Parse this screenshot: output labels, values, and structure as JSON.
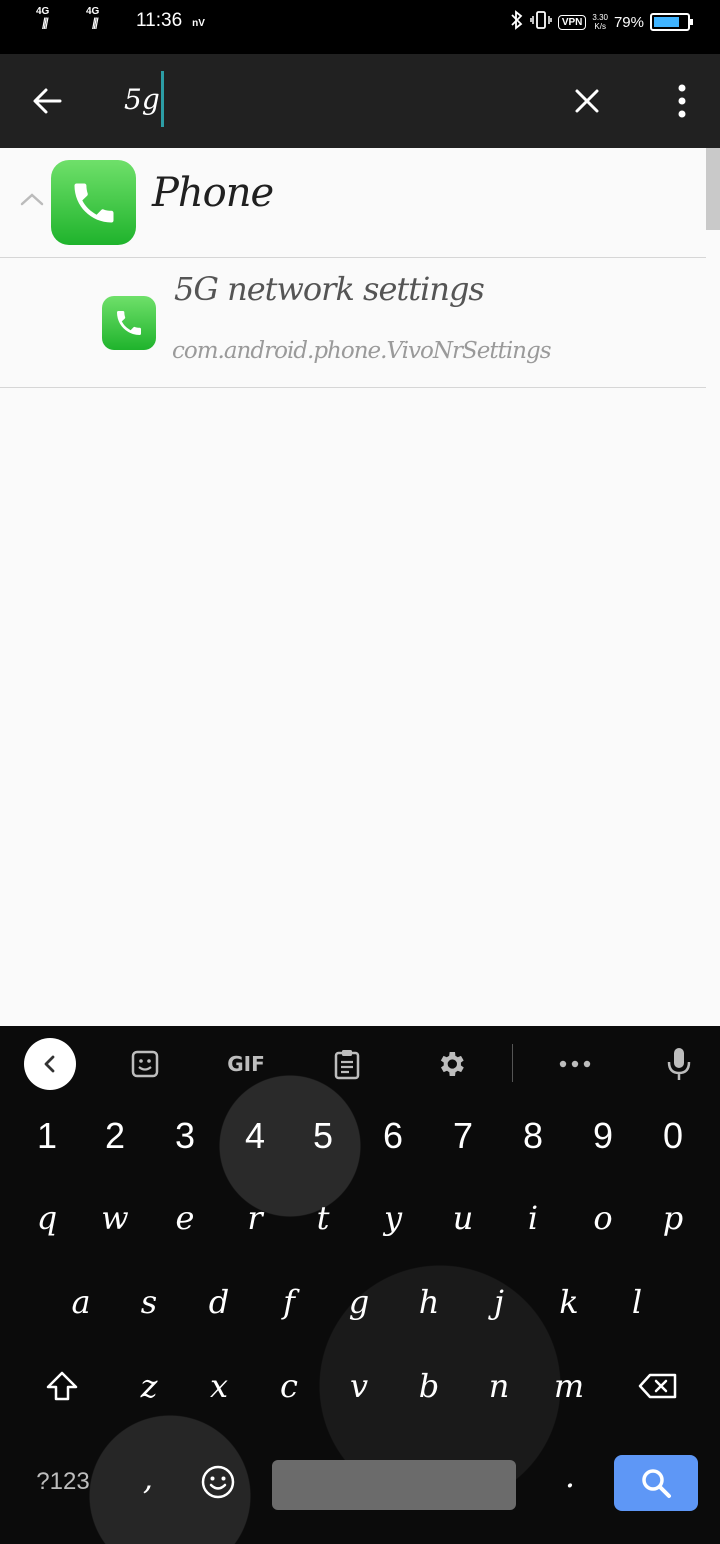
{
  "status_bar": {
    "sim1": "4G",
    "sim2": "4G",
    "signal_glyph": "ꟾꟾꟾ",
    "time": "11:36",
    "carrier": "nV",
    "vpn": "VPN",
    "speed_value": "3.30",
    "speed_unit": "K/s",
    "battery_pct": "79%",
    "battery_level": 0.79,
    "accent": "#40b4ff"
  },
  "search": {
    "query": "5g",
    "caret_color": "#2c9da5",
    "icons": {
      "back": "arrow-left-icon",
      "clear": "close-icon",
      "more": "more-vert-icon"
    }
  },
  "results": {
    "group": {
      "title": "Phone",
      "icon": "phone-app-icon",
      "expanded": true
    },
    "items": [
      {
        "title": "5G network settings",
        "subtitle": "com.android.phone.VivoNrSettings",
        "icon": "phone-app-icon"
      }
    ]
  },
  "keyboard": {
    "toolbar": {
      "gif": "GIF",
      "icons": [
        "chevron-left-icon",
        "sticker-icon",
        "clipboard-icon",
        "gear-icon",
        "more-horiz-icon",
        "mic-icon"
      ]
    },
    "row_numbers": [
      "1",
      "2",
      "3",
      "4",
      "5",
      "6",
      "7",
      "8",
      "9",
      "0"
    ],
    "row_q": [
      "q",
      "w",
      "e",
      "r",
      "t",
      "y",
      "u",
      "i",
      "o",
      "p"
    ],
    "row_a": [
      "a",
      "s",
      "d",
      "f",
      "g",
      "h",
      "j",
      "k",
      "l"
    ],
    "row_z": [
      "z",
      "x",
      "c",
      "v",
      "b",
      "n",
      "m"
    ],
    "symbols": "?123",
    "comma": ",",
    "period": ".",
    "search_color": "#5e97f6"
  }
}
